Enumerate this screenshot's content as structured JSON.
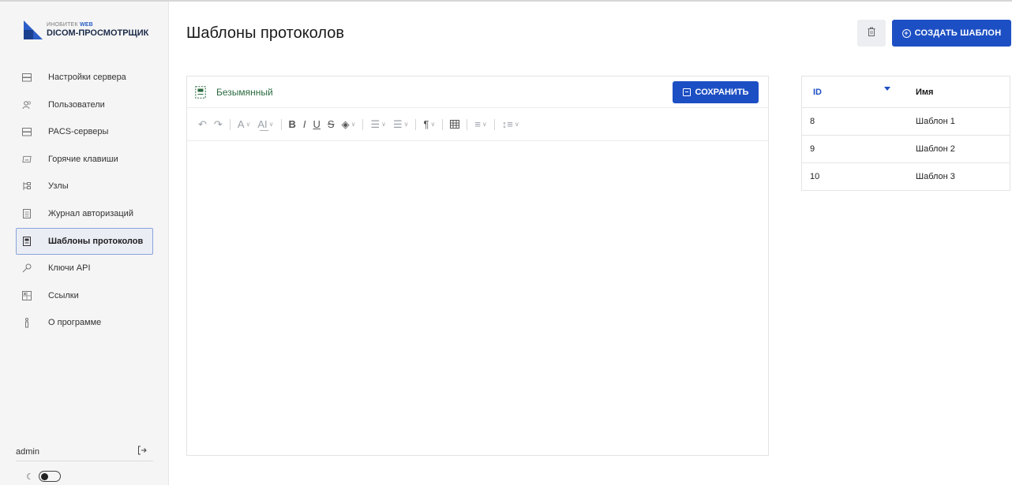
{
  "app": {
    "logo_sub": "ИНОБИТЕК",
    "logo_sub_web": "WEB",
    "logo_main": "DICOM-ПРОСМОТРЩИК",
    "brand_color": "#1d4fc4"
  },
  "sidebar": {
    "items": [
      {
        "label": "Настройки сервера",
        "icon": "server-icon",
        "active": false
      },
      {
        "label": "Пользователи",
        "icon": "users-icon",
        "active": false
      },
      {
        "label": "PACS-серверы",
        "icon": "server-icon",
        "active": false
      },
      {
        "label": "Горячие клавиши",
        "icon": "keyboard-icon",
        "active": false
      },
      {
        "label": "Узлы",
        "icon": "nodes-icon",
        "active": false
      },
      {
        "label": "Журнал авторизаций",
        "icon": "log-icon",
        "active": false
      },
      {
        "label": "Шаблоны протоколов",
        "icon": "template-icon",
        "active": true
      },
      {
        "label": "Ключи API",
        "icon": "key-icon",
        "active": false
      },
      {
        "label": "Ссылки",
        "icon": "link-icon",
        "active": false
      },
      {
        "label": "О программе",
        "icon": "info-icon",
        "active": false
      }
    ],
    "user": "admin"
  },
  "header": {
    "title": "Шаблоны протоколов",
    "create_label": "СОЗДАТЬ ШАБЛОН"
  },
  "editor": {
    "doc_name": "Безымянный",
    "save_label": "СОХРАНИТЬ",
    "content": ""
  },
  "table": {
    "columns": [
      "ID",
      "Имя"
    ],
    "rows": [
      {
        "id": "8",
        "name": "Шаблон 1"
      },
      {
        "id": "9",
        "name": "Шаблон 2"
      },
      {
        "id": "10",
        "name": "Шаблон 3"
      }
    ]
  }
}
